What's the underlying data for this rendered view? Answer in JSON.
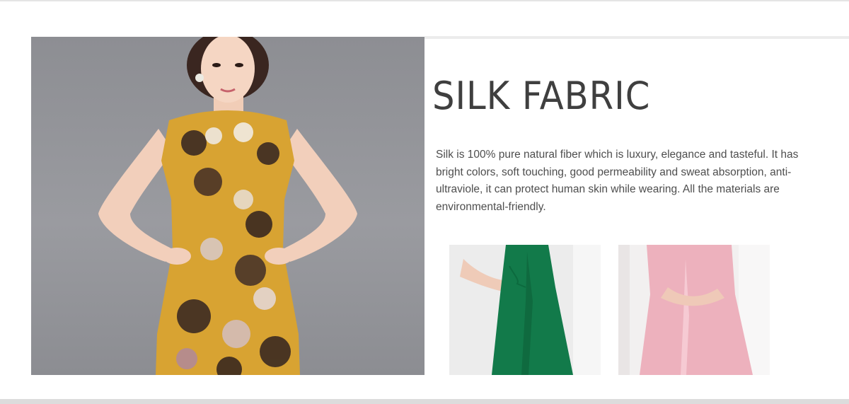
{
  "section": {
    "title": "SILK FABRIC",
    "description": "Silk is 100% pure natural fiber which is luxury, elegance and tasteful. It has bright colors, soft touching, good permeability and sweat absorption, anti-ultraviole, it can protect human skin while wearing. All the materials are environmental-friendly."
  },
  "images": {
    "hero": "model in yellow floral cheongsam",
    "thumb_1": "green silk slip dress",
    "thumb_2": "pink silk slip dress"
  },
  "colors": {
    "title": "#3f3f3f",
    "text": "#4e4e4e",
    "yellow_dress": "#d8a332",
    "green_dress": "#127a4a",
    "pink_dress": "#edb1bd",
    "hero_background": "#939499"
  }
}
